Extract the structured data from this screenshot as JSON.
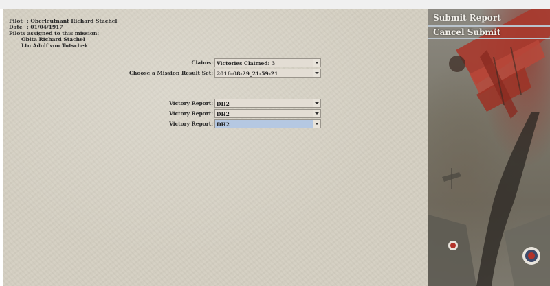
{
  "pilot_info": {
    "pilot_label": "Pilot",
    "pilot_value": ": Oberleutnant Richard Stachel",
    "date_label": "Date",
    "date_value": ": 01/04/1917",
    "assigned_heading": "Pilots assigned to this mission:",
    "assigned_pilots": [
      "Oblta Richard Stachel",
      "Ltn Adolf von Tutschek"
    ]
  },
  "form": {
    "claims_label": "Claims:",
    "claims_value": "Victories Claimed: 3",
    "mission_label": "Choose a Mission Result Set:",
    "mission_value": "2016-08-29_21-59-21",
    "victory_reports": [
      {
        "label": "Victory Report:",
        "value": "DH2"
      },
      {
        "label": "Victory Report:",
        "value": "DH2"
      },
      {
        "label": "Victory Report:",
        "value": "DH2"
      }
    ]
  },
  "sidebar": {
    "submit_label": "Submit Report",
    "cancel_label": "Cancel Submit"
  },
  "colors": {
    "paper": "#d4cfc2",
    "select_bg": "#e3ddd4",
    "select_highlight": "#b5c8e2",
    "sidebar_text": "#f2f0ea"
  }
}
